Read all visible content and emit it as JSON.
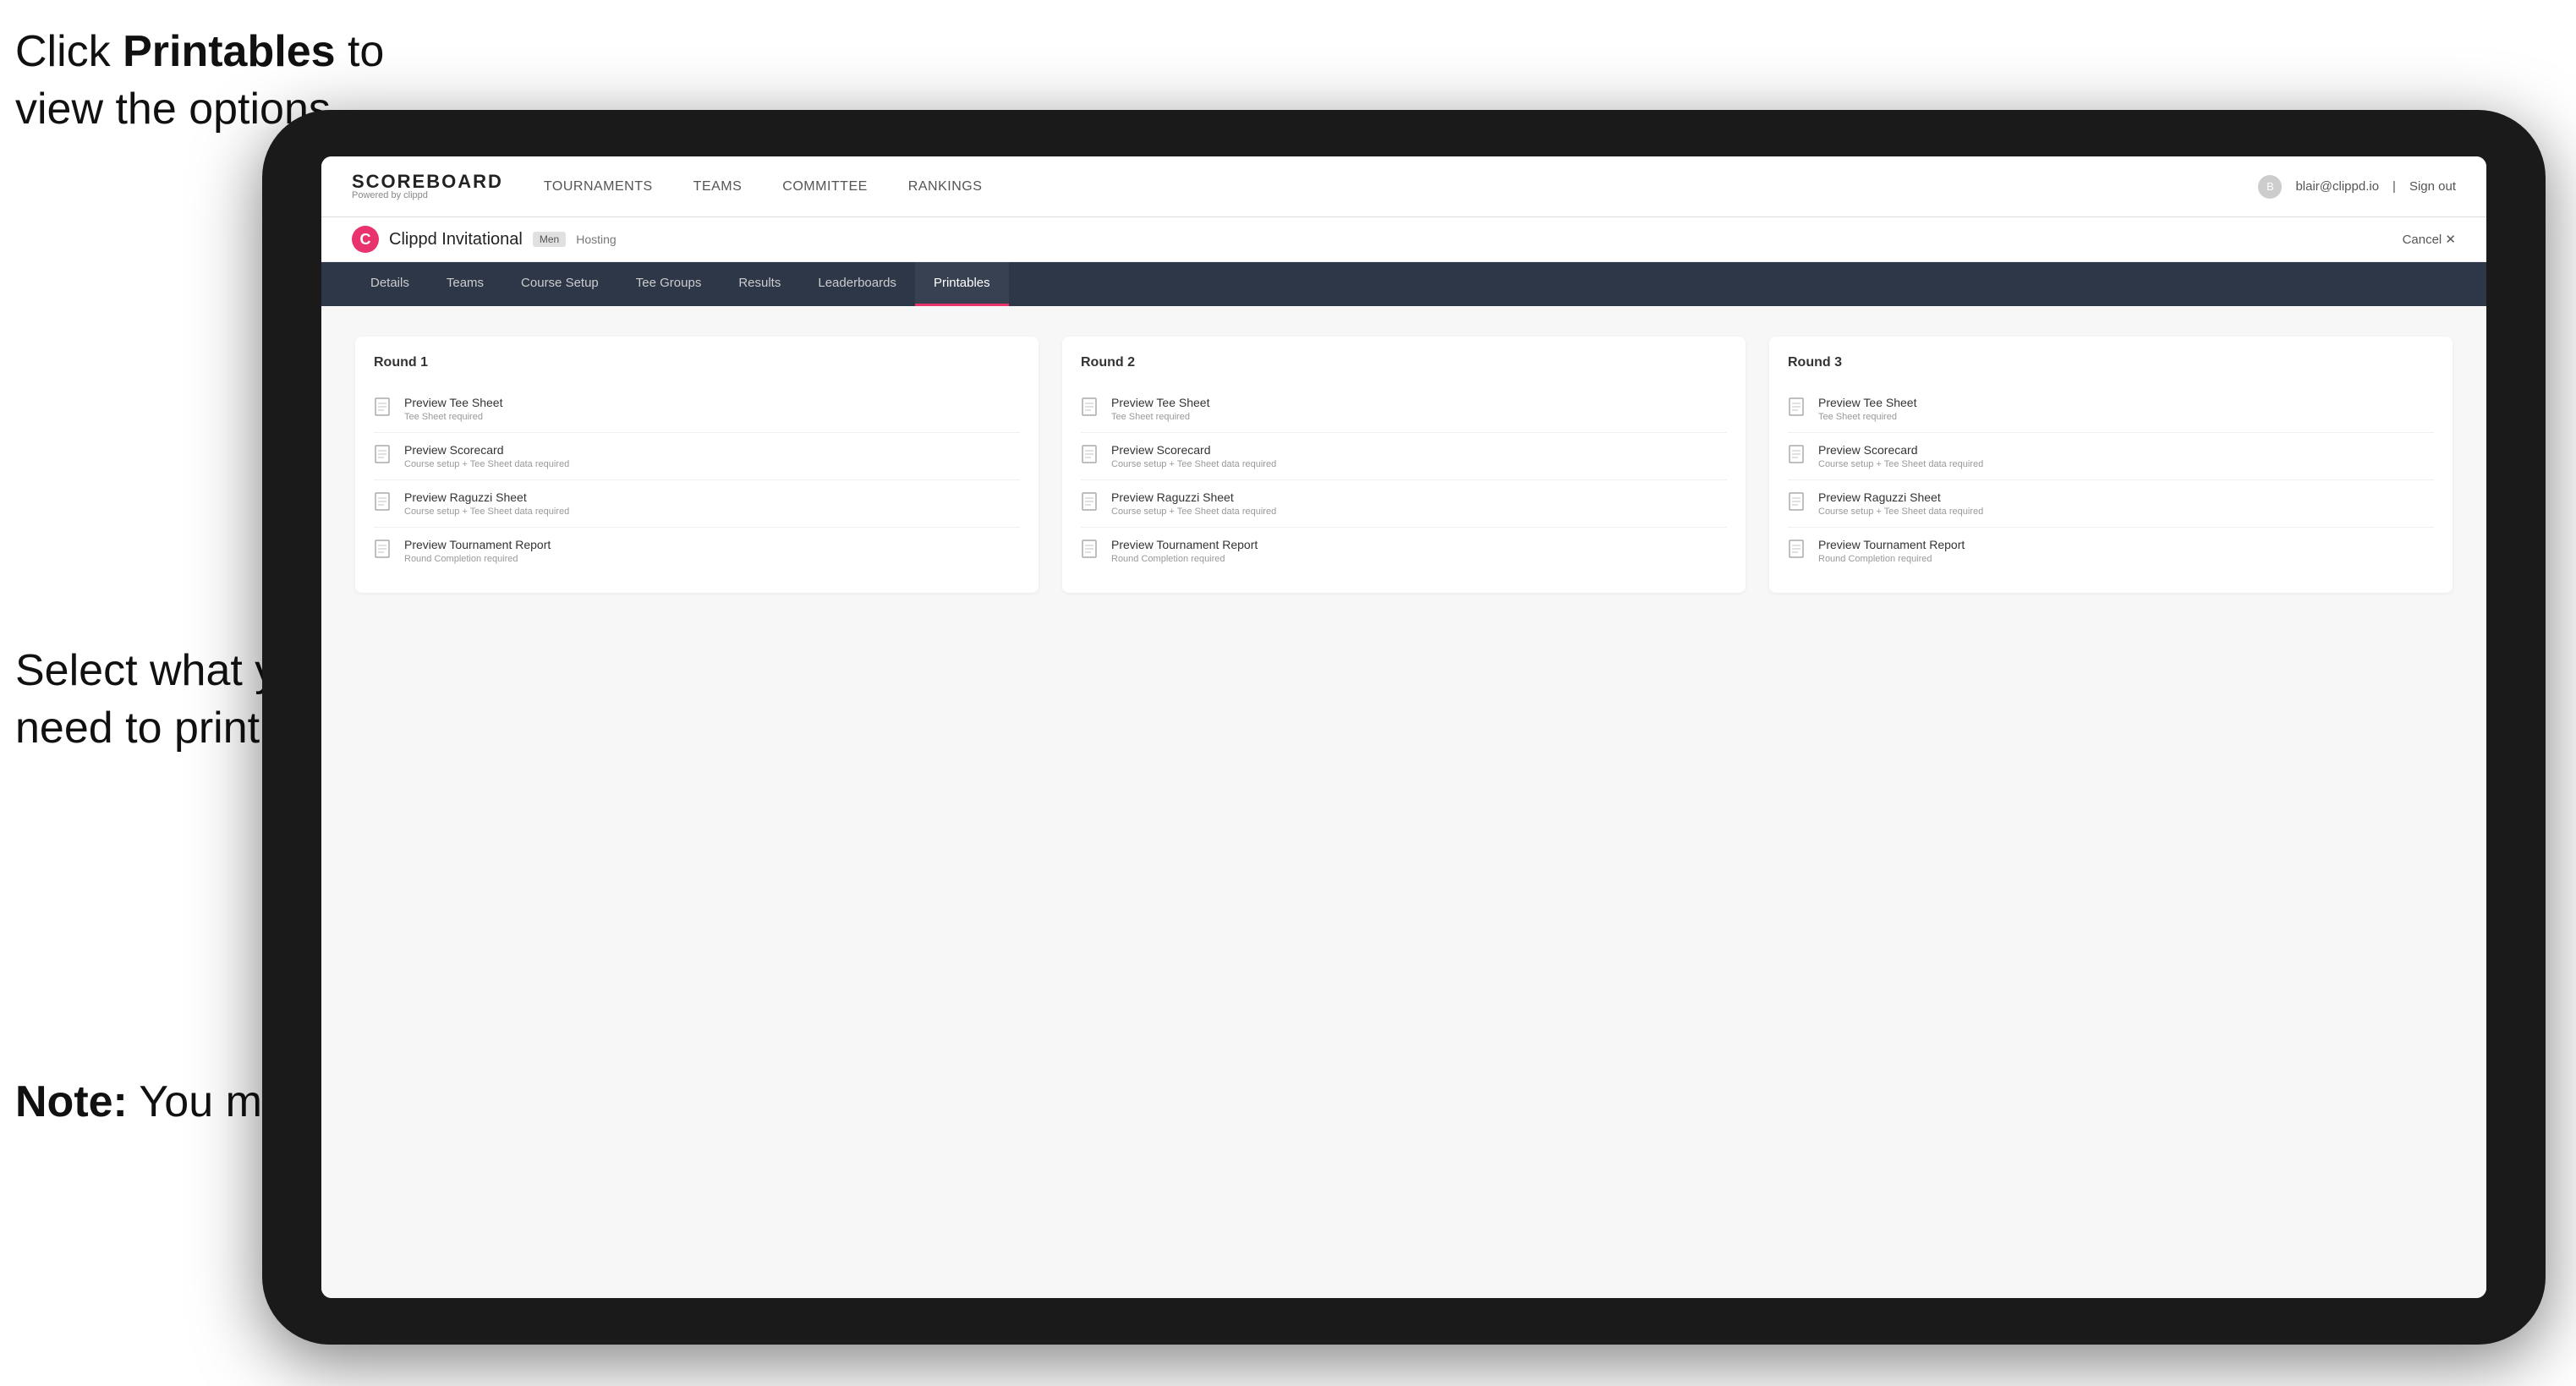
{
  "annotations": {
    "top": {
      "line1": "Click ",
      "bold": "Printables",
      "line1_end": " to",
      "line2": "view the options."
    },
    "middle": {
      "line1": "Select what you",
      "line2": "need to print."
    },
    "bottom": {
      "bold": "Note:",
      "text": " You must complete the tournament set-up to print all the options."
    }
  },
  "nav": {
    "brand": "SCOREBOARD",
    "brand_sub": "Powered by clippd",
    "links": [
      {
        "label": "TOURNAMENTS",
        "active": false
      },
      {
        "label": "TEAMS",
        "active": false
      },
      {
        "label": "COMMITTEE",
        "active": false
      },
      {
        "label": "RANKINGS",
        "active": false
      }
    ],
    "user_email": "blair@clippd.io",
    "sign_out": "Sign out",
    "separator": "|"
  },
  "tournament": {
    "logo_letter": "C",
    "name": "Clippd Invitational",
    "gender_badge": "Men",
    "hosting_label": "Hosting",
    "cancel_label": "Cancel ✕"
  },
  "sub_nav": {
    "items": [
      {
        "label": "Details",
        "active": false
      },
      {
        "label": "Teams",
        "active": false
      },
      {
        "label": "Course Setup",
        "active": false
      },
      {
        "label": "Tee Groups",
        "active": false
      },
      {
        "label": "Results",
        "active": false
      },
      {
        "label": "Leaderboards",
        "active": false
      },
      {
        "label": "Printables",
        "active": true
      }
    ]
  },
  "rounds": [
    {
      "title": "Round 1",
      "items": [
        {
          "title": "Preview Tee Sheet",
          "subtitle": "Tee Sheet required"
        },
        {
          "title": "Preview Scorecard",
          "subtitle": "Course setup + Tee Sheet data required"
        },
        {
          "title": "Preview Raguzzi Sheet",
          "subtitle": "Course setup + Tee Sheet data required"
        },
        {
          "title": "Preview Tournament Report",
          "subtitle": "Round Completion required"
        }
      ]
    },
    {
      "title": "Round 2",
      "items": [
        {
          "title": "Preview Tee Sheet",
          "subtitle": "Tee Sheet required"
        },
        {
          "title": "Preview Scorecard",
          "subtitle": "Course setup + Tee Sheet data required"
        },
        {
          "title": "Preview Raguzzi Sheet",
          "subtitle": "Course setup + Tee Sheet data required"
        },
        {
          "title": "Preview Tournament Report",
          "subtitle": "Round Completion required"
        }
      ]
    },
    {
      "title": "Round 3",
      "items": [
        {
          "title": "Preview Tee Sheet",
          "subtitle": "Tee Sheet required"
        },
        {
          "title": "Preview Scorecard",
          "subtitle": "Course setup + Tee Sheet data required"
        },
        {
          "title": "Preview Raguzzi Sheet",
          "subtitle": "Course setup + Tee Sheet data required"
        },
        {
          "title": "Preview Tournament Report",
          "subtitle": "Round Completion required"
        }
      ]
    }
  ]
}
